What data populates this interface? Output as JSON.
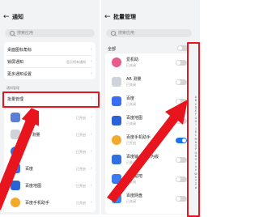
{
  "left": {
    "back_glyph": "←",
    "title": "通知",
    "search_placeholder": "搜索应用",
    "settings": [
      {
        "label": "桌面图标角标",
        "value": "",
        "chevron": "›"
      },
      {
        "label": "锁屏通知",
        "value": "显示所有通知",
        "chevron": "›"
      },
      {
        "label": "更多通知设置",
        "value": "",
        "chevron": "›"
      }
    ],
    "section_label": "通知管理",
    "batch_label": "批量管理",
    "apps": [
      {
        "name": "",
        "sub": "",
        "value": "已开启",
        "color": "#5b7fd6"
      },
      {
        "name": "AR 测量",
        "sub": "",
        "value": "已开启",
        "color": "#d0d4da"
      },
      {
        "name": "",
        "sub": "",
        "value": "已开启",
        "color": "#2f6fe0"
      },
      {
        "name": "百度",
        "sub": "",
        "value": "已开启",
        "color": "#3a6cf0"
      },
      {
        "name": "百度地图",
        "sub": "",
        "value": "已开启",
        "color": "#2a62d8"
      },
      {
        "name": "百度手机助手",
        "sub": "",
        "value": "已开启",
        "color": "#f3a92c"
      }
    ],
    "chevron": "›"
  },
  "right": {
    "back_glyph": "←",
    "title": "批量管理",
    "search_placeholder": "搜索应用",
    "all_label": "全部",
    "apps": [
      {
        "name": "爱机助",
        "sub": "已关闭",
        "on": false,
        "color": "#e85a8a"
      },
      {
        "name": "AR 测量",
        "sub": "已关闭",
        "on": false,
        "color": "#d0d4da"
      },
      {
        "name": "百度",
        "sub": "已关闭",
        "on": false,
        "color": "#3a6cf0"
      },
      {
        "name": "百度地图",
        "sub": "已关闭",
        "on": false,
        "color": "#2a62d8"
      },
      {
        "name": "百度手机助手",
        "sub": "已开启",
        "on": true,
        "color": "#f3a92c"
      },
      {
        "name": "百度输入法华为版",
        "sub": "已关闭",
        "on": false,
        "color": "#2f6fe0"
      },
      {
        "name": "百度贴吧",
        "sub": "已关闭",
        "on": false,
        "color": "#3b7bf0"
      },
      {
        "name": "百度网盘",
        "sub": "已关闭",
        "on": false,
        "color": "#2a8cf0"
      }
    ],
    "alphabet": [
      "A",
      "B",
      "C",
      "D",
      "E",
      "F",
      "G",
      "H",
      "I",
      "J",
      "K",
      "L",
      "M",
      "N",
      "O",
      "P",
      "Q",
      "R",
      "S",
      "T",
      "U",
      "V",
      "W",
      "X",
      "Y",
      "Z",
      "#"
    ]
  },
  "colors": {
    "highlight": "#e8141e",
    "toggle_on": "#1a73e8",
    "toggle_off": "#d6d6d6",
    "screen_bg": "#f1f3f5"
  }
}
